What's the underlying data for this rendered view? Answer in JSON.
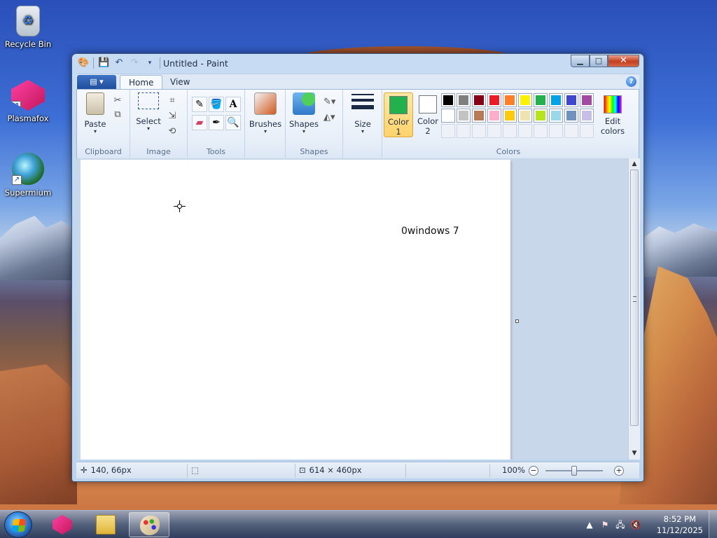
{
  "desktop": {
    "icons": [
      {
        "label": "Recycle Bin"
      },
      {
        "label": "Plasmafox"
      },
      {
        "label": "Supermium"
      }
    ]
  },
  "window": {
    "title": "Untitled - Paint",
    "tabs": {
      "home": "Home",
      "view": "View"
    },
    "help_glyph": "?"
  },
  "ribbon": {
    "clipboard": {
      "label": "Clipboard",
      "paste": "Paste"
    },
    "image": {
      "label": "Image",
      "select": "Select"
    },
    "tools": {
      "label": "Tools"
    },
    "brushes": {
      "label": "Brushes"
    },
    "shapes": {
      "label": "Shapes",
      "button": "Shapes"
    },
    "size": {
      "label": "Size"
    },
    "colors": {
      "label": "Colors",
      "color1_line1": "Color",
      "color1_line2": "1",
      "color2_line1": "Color",
      "color2_line2": "2",
      "edit_line1": "Edit",
      "edit_line2": "colors",
      "color1_value": "#22b14c",
      "color2_value": "#ffffff",
      "palette_row1": [
        "#000000",
        "#7f7f7f",
        "#880015",
        "#ed1c24",
        "#ff7f27",
        "#fff200",
        "#22b14c",
        "#00a2e8",
        "#3f48cc",
        "#a349a4"
      ],
      "palette_row2": [
        "#ffffff",
        "#c3c3c3",
        "#b97a57",
        "#ffaec9",
        "#ffc90e",
        "#efe4b0",
        "#b5e61d",
        "#99d9ea",
        "#7092be",
        "#c8bfe7"
      ]
    }
  },
  "canvas": {
    "text": "0windows 7"
  },
  "status": {
    "cursor_pos": "140, 66px",
    "image_size": "614 × 460px",
    "zoom": "100%"
  },
  "taskbar": {
    "time": "8:52 PM",
    "date": "11/12/2025"
  }
}
